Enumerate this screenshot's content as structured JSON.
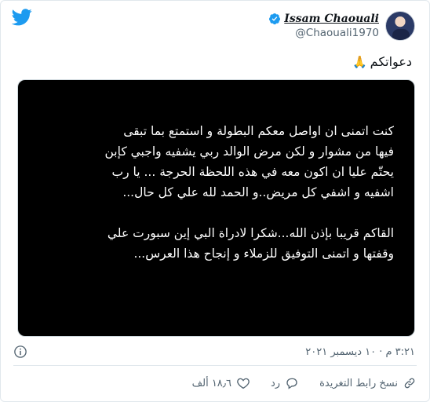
{
  "author": {
    "display_name": "Issam Chaouali",
    "handle": "@Chaouali1970",
    "verified": true
  },
  "tweet": {
    "text": "دعواتكم",
    "emoji_icon": "folded-hands-icon",
    "media_lines": [
      "كنت اتمنى ان اواصل معكم البطولة و استمتع بما تبقى",
      "فيها من مشوار و لكن مرض الوالد ربي يشفيه واجبي كإبن",
      "يحتّم عليا ان اكون معه في هذه اللحظة الحرجة ... يا رب",
      "اشفيه و اشفي كل مريض..و الحمد لله  علي كل حال...",
      "",
      "القاكم قريبا بإذن الله...شكرا لادراة البي إين سبورت علي",
      "وقفتها و اتمنى التوفيق للزملاء و إنجاح هذا العرس..."
    ]
  },
  "meta": {
    "timestamp": "٣:٢١ م · ١٠ ديسمبر ٢٠٢١"
  },
  "actions": {
    "like_count": "١٨٫٦ ألف",
    "reply_label": "رد",
    "copy_link_label": "نسخ رابط التغريدة"
  },
  "colors": {
    "twitter_blue": "#1d9bf0",
    "secondary_text": "#536471",
    "like_red": "#f91880"
  }
}
